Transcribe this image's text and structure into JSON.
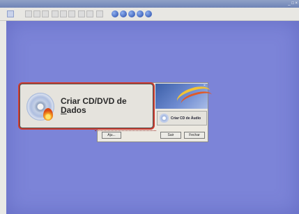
{
  "window": {
    "title": "",
    "controls": "_ □ ×"
  },
  "toolbar": {
    "icons": [
      "app-icon",
      "save-icon",
      "close-icon",
      "cut-icon",
      "copy-icon",
      "paste-icon",
      "undo-icon",
      "redo-icon",
      "properties-icon",
      "view-icon",
      "globe-icon",
      "globe-icon",
      "globe-icon",
      "info-icon",
      "help-icon"
    ]
  },
  "main_button": {
    "label_line1": "Criar CD/DVD de",
    "label_line2_underlined": "D",
    "label_line2_rest": "ados"
  },
  "dialog": {
    "audio_label": "Criar CD de Áudio",
    "help_label": "Aju...",
    "ok_label": "Sair",
    "cancel_label": "Fechar",
    "close_glyph": "×"
  },
  "colors": {
    "desktop": "#7c84d8",
    "focus_border": "#ce3c30",
    "titlebar": "#6f84b6"
  }
}
